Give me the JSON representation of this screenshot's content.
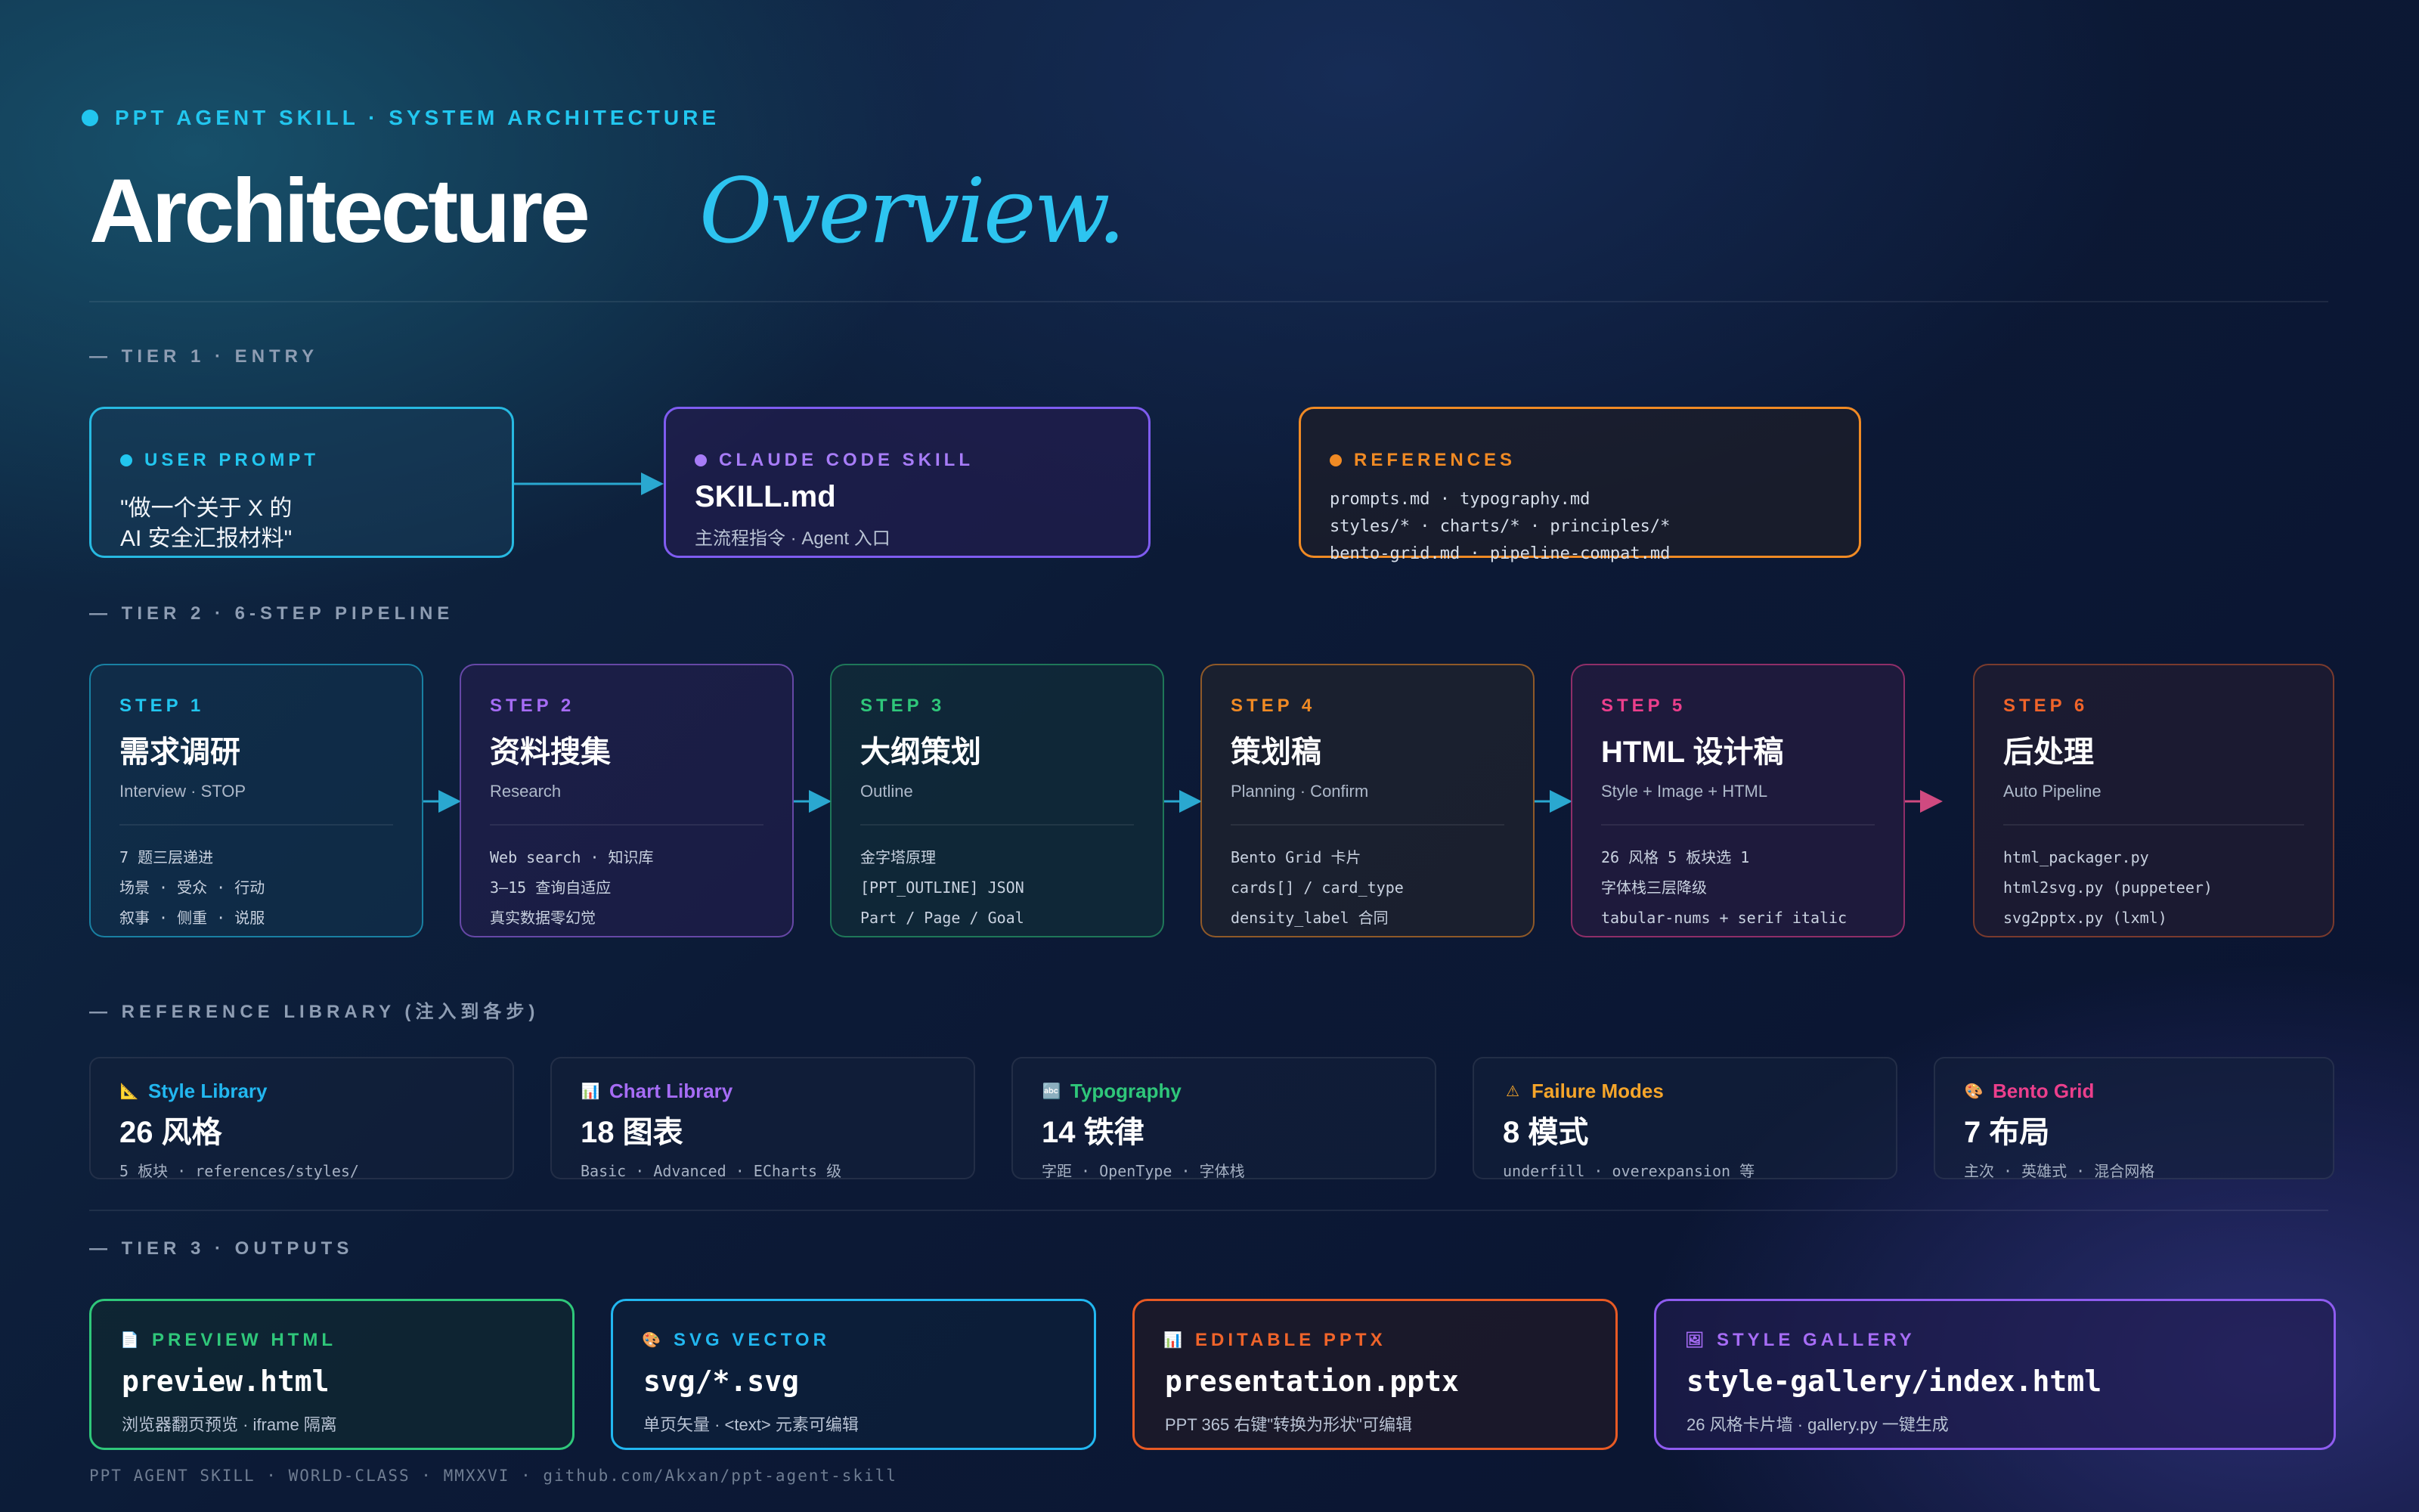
{
  "header": {
    "eyebrow": "PPT AGENT SKILL · SYSTEM ARCHITECTURE",
    "title_main": "Architecture",
    "title_italic": "Overview."
  },
  "tiers": {
    "tier1": "— TIER 1 · ENTRY",
    "tier2": "— TIER 2 · 6-STEP PIPELINE",
    "library": "— REFERENCE LIBRARY (注入到各步)",
    "tier3": "— TIER 3 · OUTPUTS"
  },
  "entry": {
    "user_prompt": {
      "label": "USER PROMPT",
      "line1": "\"做一个关于 X 的",
      "line2": "AI 安全汇报材料\"",
      "color": "#27b9e1"
    },
    "skill": {
      "label": "CLAUDE CODE SKILL",
      "title": "SKILL.md",
      "desc": "主流程指令 · Agent 入口",
      "color": "#9b6cf5"
    },
    "references": {
      "label": "REFERENCES",
      "line1": "prompts.md · typography.md",
      "line2": "styles/* · charts/* · principles/*",
      "line3": "bento-grid.md · pipeline-compat.md",
      "color": "#f08a24"
    }
  },
  "steps": [
    {
      "label": "STEP 1",
      "title": "需求调研",
      "sub": "Interview · STOP",
      "lines": [
        "7 题三层递进",
        "场景 · 受众 · 行动",
        "叙事 · 侧重 · 说服"
      ],
      "color": "#22c6ef"
    },
    {
      "label": "STEP 2",
      "title": "资料搜集",
      "sub": "Research",
      "lines": [
        "Web search · 知识库",
        "3–15 查询自适应",
        "真实数据零幻觉"
      ],
      "color": "#a66cf5"
    },
    {
      "label": "STEP 3",
      "title": "大纲策划",
      "sub": "Outline",
      "lines": [
        "金字塔原理",
        "[PPT_OUTLINE] JSON",
        "Part / Page / Goal"
      ],
      "color": "#2fc77a"
    },
    {
      "label": "STEP 4",
      "title": "策划稿",
      "sub": "Planning · Confirm",
      "lines": [
        "Bento Grid 卡片",
        "cards[] / card_type",
        "density_label 合同"
      ],
      "color": "#f08a24"
    },
    {
      "label": "STEP 5",
      "title": "HTML 设计稿",
      "sub": "Style + Image + HTML",
      "lines": [
        "26 风格 5 板块选 1",
        "字体栈三层降级",
        "tabular-nums + serif italic"
      ],
      "color": "#ec3f8c"
    },
    {
      "label": "STEP 6",
      "title": "后处理",
      "sub": "Auto Pipeline",
      "lines": [
        "html_packager.py",
        "html2svg.py (puppeteer)",
        "svg2pptx.py (lxml)"
      ],
      "color": "#f0642a"
    }
  ],
  "library": [
    {
      "icon": "ruler-icon",
      "glyph": "📐",
      "title": "Style Library",
      "value": "26 风格",
      "desc": "5 板块 · references/styles/",
      "color": "#22b7f0"
    },
    {
      "icon": "chart-icon",
      "glyph": "📊",
      "title": "Chart Library",
      "value": "18 图表",
      "desc": "Basic · Advanced · ECharts 级",
      "color": "#a66cf5"
    },
    {
      "icon": "type-icon",
      "glyph": "🔤",
      "title": "Typography",
      "value": "14 铁律",
      "desc": "字距 · OpenType · 字体栈",
      "color": "#2fc77a"
    },
    {
      "icon": "warning-icon",
      "glyph": "⚠",
      "title": "Failure Modes",
      "value": "8 模式",
      "desc": "underfill · overexpansion 等",
      "color": "#f5a52a"
    },
    {
      "icon": "palette-icon",
      "glyph": "🎨",
      "title": "Bento Grid",
      "value": "7 布局",
      "desc": "主次 · 英雄式 · 混合网格",
      "color": "#ec3f8c"
    }
  ],
  "outputs": [
    {
      "icon": "document-icon",
      "glyph": "📄",
      "label": "PREVIEW HTML",
      "title": "preview.html",
      "desc": "浏览器翻页预览 · iframe 隔离",
      "color": "#2fc77a"
    },
    {
      "icon": "palette-icon",
      "glyph": "🎨",
      "label": "SVG VECTOR",
      "title": "svg/*.svg",
      "desc": "单页矢量 · <text> 元素可编辑",
      "color": "#22b7f0"
    },
    {
      "icon": "chart-icon",
      "glyph": "📊",
      "label": "EDITABLE PPTX",
      "title": "presentation.pptx",
      "desc": "PPT 365 右键\"转换为形状\"可编辑",
      "color": "#f0642a"
    },
    {
      "icon": "gallery-icon",
      "glyph": "🖼",
      "label": "STYLE GALLERY",
      "title": "style-gallery/index.html",
      "desc": "26 风格卡片墙 · gallery.py 一键生成",
      "color": "#9b6cf5"
    }
  ],
  "footer": "PPT AGENT SKILL · WORLD-CLASS · MMXXVI · github.com/Akxan/ppt-agent-skill"
}
